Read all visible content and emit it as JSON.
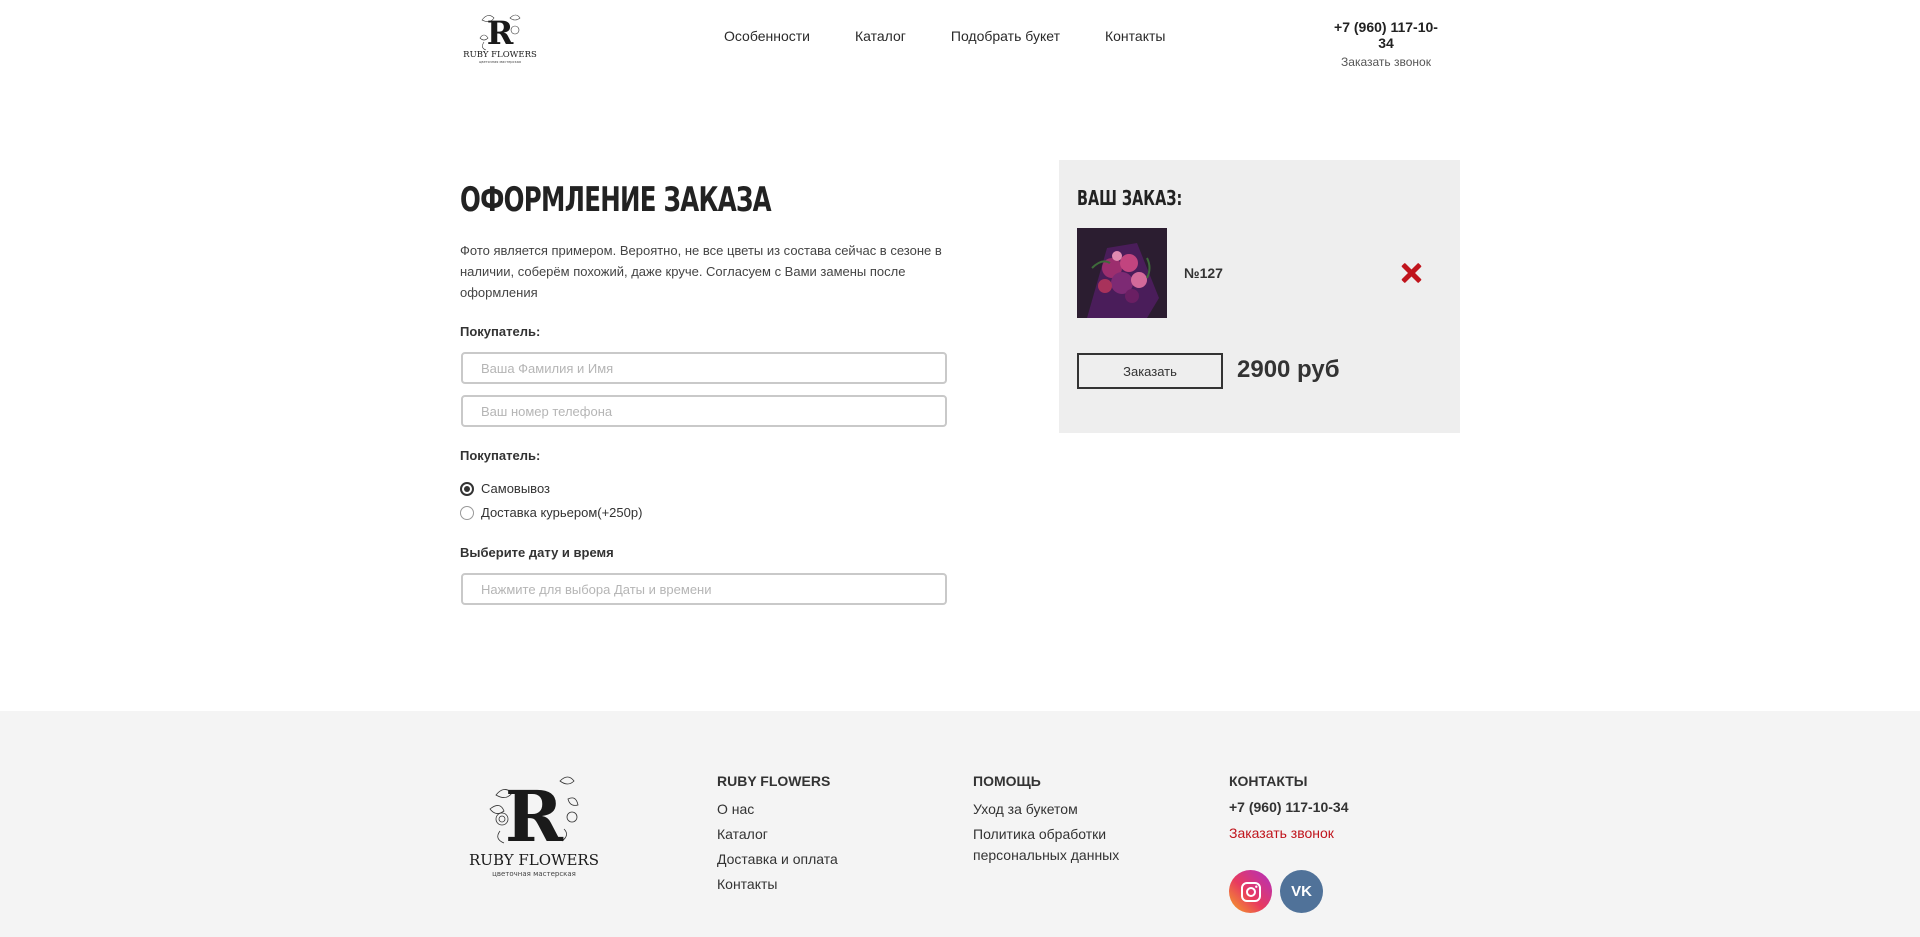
{
  "header": {
    "logo_text": "RUBY FLOWERS",
    "logo_sub": "цветочная мастерская",
    "nav": [
      "Особенности",
      "Каталог",
      "Подобрать букет",
      "Контакты"
    ],
    "phone": "+7 (960) 117-10-34",
    "callback": "Заказать звонок"
  },
  "main": {
    "title": "ОФОРМЛЕНИЕ ЗАКАЗА",
    "note": "Фото является примером. Вероятно, не все цветы из состава сейчас в сезоне в наличии, соберём похожий, даже круче. Согласуем с Вами замены после оформления",
    "buyer_label": "Покупатель:",
    "name_placeholder": "Ваша Фамилия и Имя",
    "phone_placeholder": "Ваш номер телефона",
    "delivery_label": "Покупатель:",
    "delivery_options": [
      {
        "label": "Самовывоз",
        "checked": true
      },
      {
        "label": "Доставка курьером(+250р)",
        "checked": false
      }
    ],
    "date_label": "Выберите дату и время",
    "date_placeholder": "Нажмите для выбора Даты и времени"
  },
  "order": {
    "title": "ВАШ ЗАКАЗ:",
    "item_name": "№127",
    "button": "Заказать",
    "price": "2900 руб"
  },
  "footer": {
    "logo_text": "RUBY FLOWERS",
    "logo_sub": "цветочная мастерская",
    "col1": {
      "title": "RUBY FLOWERS",
      "links": [
        "О нас",
        "Каталог",
        "Доставка и оплата",
        "Контакты"
      ]
    },
    "col2": {
      "title": "ПОМОЩЬ",
      "links": [
        "Уход за букетом",
        "Политика обработки персональных данных"
      ]
    },
    "col3": {
      "title": "КОНТАКТЫ",
      "phone": "+7 (960) 117-10-34",
      "callback": "Заказать звонок"
    },
    "vk_label": "VK"
  },
  "colors": {
    "accent": "#c0141c",
    "order_bg": "#eeeeee",
    "footer_bg": "#f4f4f4"
  }
}
